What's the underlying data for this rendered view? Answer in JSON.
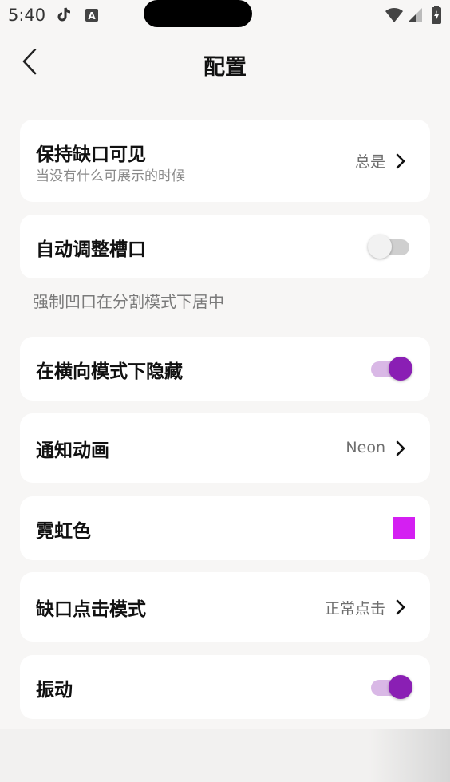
{
  "status_bar": {
    "time": "5:40",
    "icons": [
      "tiktok-icon",
      "a-box-icon",
      "wifi-icon",
      "signal-icon",
      "battery-icon"
    ]
  },
  "header": {
    "title": "配置"
  },
  "settings": {
    "keep_notch_visible": {
      "label": "保持缺口可见",
      "sublabel": "当没有什么可展示的时候",
      "value": "总是"
    },
    "auto_adjust_slot": {
      "label": "自动调整槽口",
      "enabled": false
    },
    "note": "强制凹口在分割模式下居中",
    "hide_landscape": {
      "label": "在横向模式下隐藏",
      "enabled": true
    },
    "notification_animation": {
      "label": "通知动画",
      "value": "Neon"
    },
    "neon_color": {
      "label": "霓虹色",
      "color": "#d41ff2"
    },
    "notch_click_mode": {
      "label": "缺口点击模式",
      "value": "正常点击"
    },
    "vibration": {
      "label": "振动",
      "enabled": true
    }
  },
  "colors": {
    "accent": "#8a1fb4",
    "accent_track": "#d9b8e6",
    "background": "#f7f6f5",
    "card": "#ffffff"
  }
}
